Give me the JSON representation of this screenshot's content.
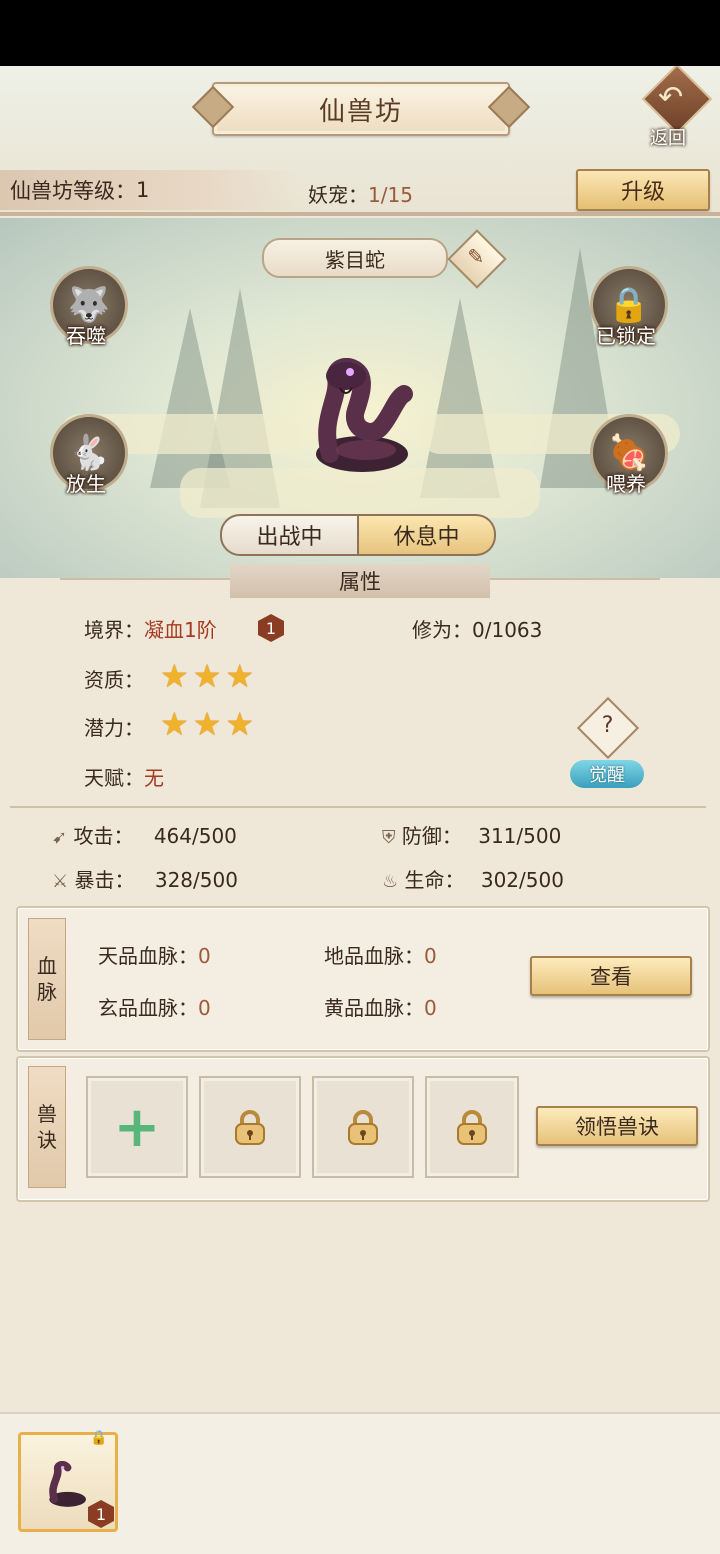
{
  "header": {
    "title": "仙兽坊",
    "back_label": "返回",
    "level_label": "仙兽坊等级：",
    "level_value": "1",
    "pet_label": "妖宠：",
    "pet_count": "1/15",
    "upgrade_label": "升级"
  },
  "pet": {
    "name": "紫目蛇",
    "actions": {
      "devour": "吞噬",
      "release": "放生",
      "locked": "已锁定",
      "feed": "喂养"
    },
    "status_tabs": [
      "出战中",
      "休息中"
    ],
    "active_tab_index": 1
  },
  "attributes": {
    "header": "属性",
    "realm_label": "境界：",
    "realm_value": "凝血1阶",
    "realm_badge": "1",
    "cultivation_label": "修为：",
    "cultivation_value": "0/1063",
    "aptitude_label": "资质：",
    "aptitude_stars": 3,
    "potential_label": "潜力：",
    "potential_stars": 3,
    "talent_label": "天赋：",
    "talent_value": "无",
    "question_mark": "?",
    "awaken_label": "觉醒",
    "attack_label": "攻击：",
    "attack_value": "464/500",
    "defense_label": "防御：",
    "defense_value": "311/500",
    "crit_label": "暴击：",
    "crit_value": "328/500",
    "life_label": "生命：",
    "life_value": "302/500"
  },
  "bloodline": {
    "tag": [
      "血",
      "脉"
    ],
    "heaven_label": "天品血脉：",
    "heaven_value": "0",
    "earth_label": "地品血脉：",
    "earth_value": "0",
    "mystic_label": "玄品血脉：",
    "mystic_value": "0",
    "yellow_label": "黄品血脉：",
    "yellow_value": "0",
    "view_label": "查看"
  },
  "skills": {
    "tag": [
      "兽",
      "诀"
    ],
    "learn_label": "领悟兽诀"
  },
  "bottom": {
    "card_level": "1"
  },
  "colors": {
    "gold_star": "#f2b12a",
    "accent_red": "#a63a22",
    "awaken_blue": "#3aa0bd"
  }
}
